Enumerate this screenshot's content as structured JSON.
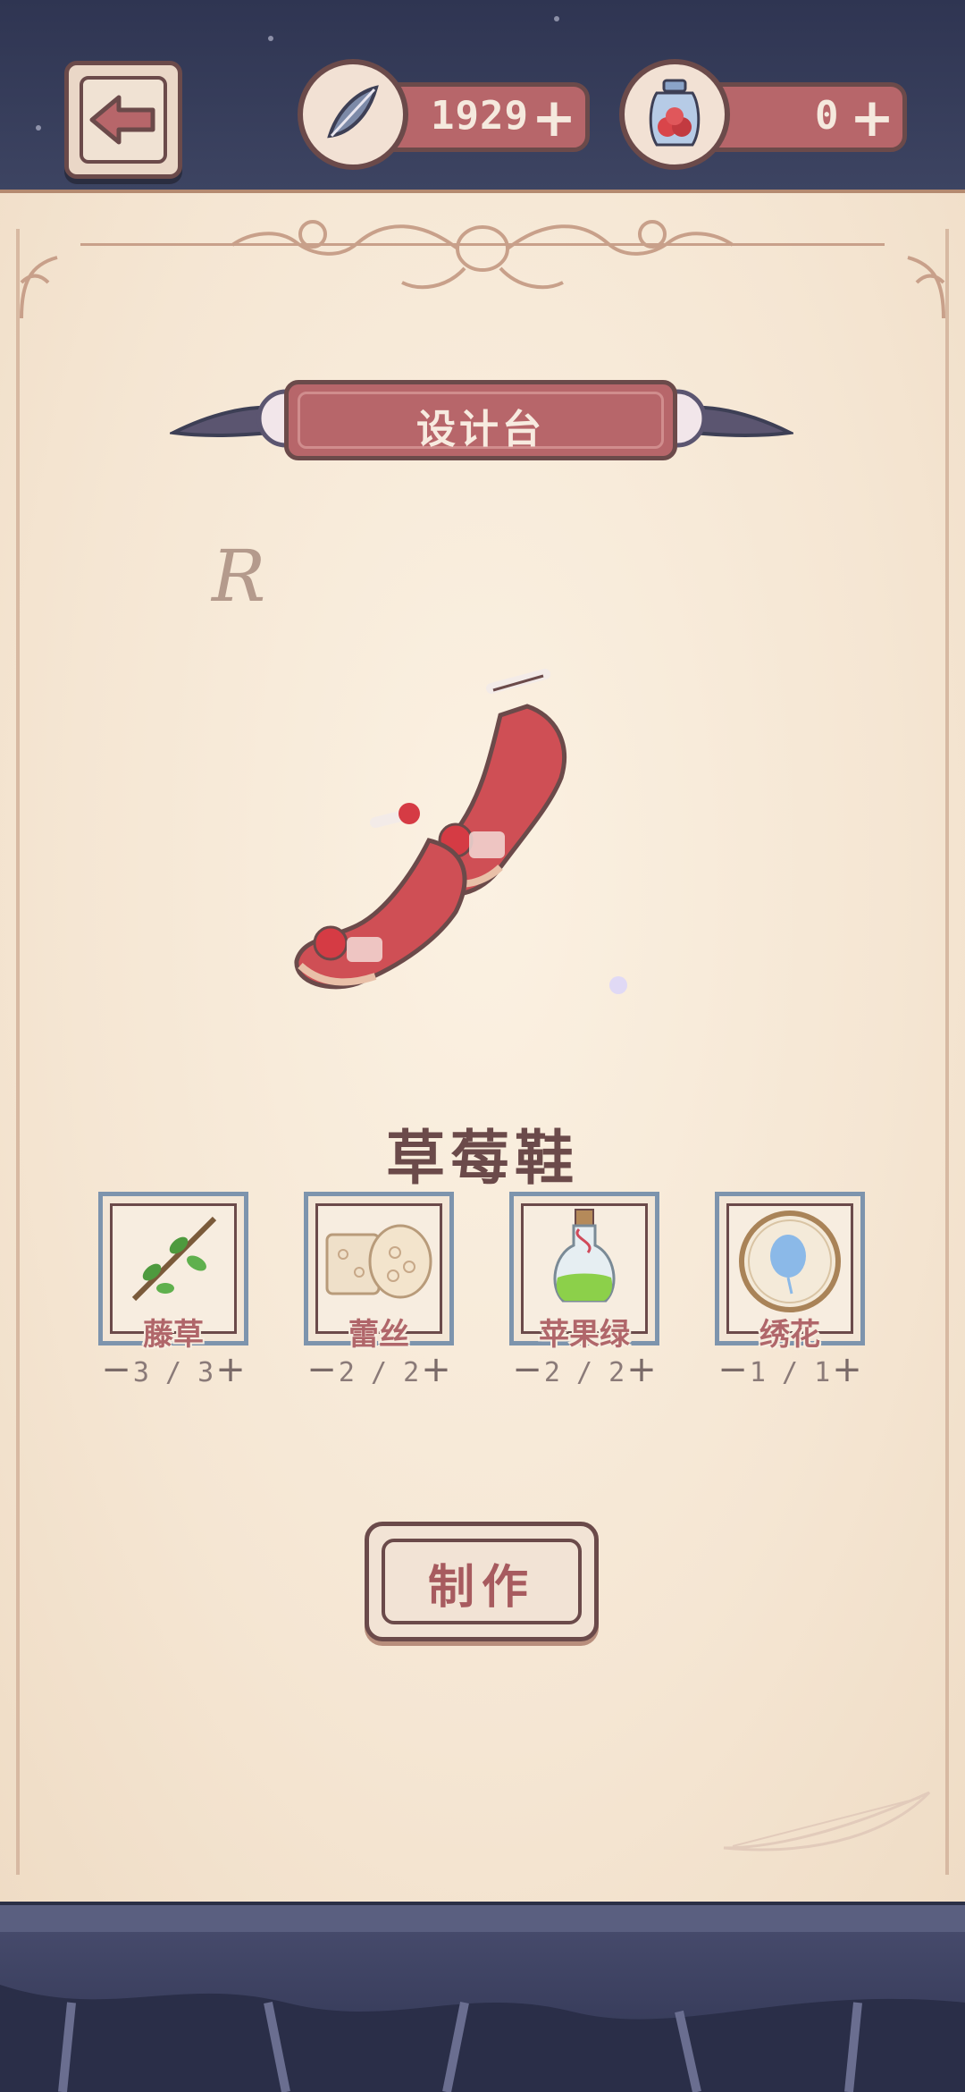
{
  "header": {
    "back_icon": "arrow-left-icon",
    "feather_currency": {
      "icon": "feather-icon",
      "value": "1929",
      "add": "+"
    },
    "jar_currency": {
      "icon": "berry-jar-icon",
      "value": "0",
      "add": "+"
    }
  },
  "panel": {
    "title": "设计台",
    "rarity": "R",
    "item_name": "草莓鞋",
    "make_button": "制作"
  },
  "materials": [
    {
      "name": "藤草",
      "count": "3 / 3",
      "icon": "vine-icon",
      "minus": "−",
      "plus": "+"
    },
    {
      "name": "蕾丝",
      "count": "2 / 2",
      "icon": "lace-icon",
      "minus": "−",
      "plus": "+"
    },
    {
      "name": "苹果绿",
      "count": "2 / 2",
      "icon": "green-potion-icon",
      "minus": "−",
      "plus": "+"
    },
    {
      "name": "绣花",
      "count": "1 / 1",
      "icon": "embroidery-hoop-icon",
      "minus": "−",
      "plus": "+"
    }
  ],
  "colors": {
    "accent": "#b7666a",
    "outline": "#6b4a4a",
    "parchment": "#f5e6d3",
    "frame_blue": "#7d94ad"
  }
}
